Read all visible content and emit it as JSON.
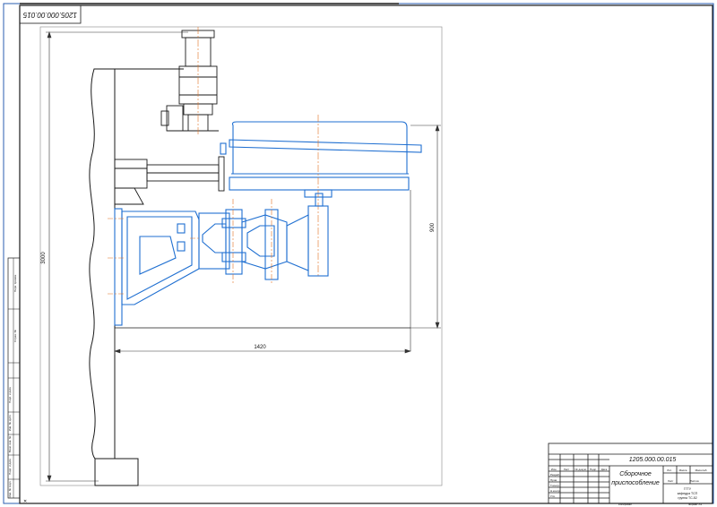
{
  "drawing": {
    "code": "1205.000.00.015",
    "code_rotated": "1205.000.00.015",
    "title_line1": "Сборочное",
    "title_line2": "приспособление"
  },
  "dimensions": {
    "height_left": "3000",
    "height_right": "900",
    "width_bottom": "1420"
  },
  "title_block": {
    "col_headers": [
      "Изм.",
      "Лист",
      "№ докум.",
      "Подп.",
      "Дата"
    ],
    "rows": [
      "Разраб.",
      "Пров.",
      "Т.контр.",
      "Н.контр.",
      "Утв."
    ],
    "stage_label": "Лит.",
    "mass_label": "Масса",
    "scale_label": "Масштаб",
    "sheet_label": "Лист",
    "sheets_label": "Листов",
    "org_line1": "ГГТУ",
    "org_line2": "кафедра ТСП",
    "org_line3": "группа ТС-52",
    "copied_label": "Копировал",
    "format_label": "Формат A1"
  },
  "side_stamp": {
    "labels": [
      "Перв. примен.",
      "Справ. №",
      "Подп. и дата",
      "Инв. № дубл.",
      "Взам. инв. №",
      "Подп. и дата",
      "Инв. № подл."
    ]
  },
  "colors": {
    "part_outline": "#1f6fd1",
    "frame": "#1a1a1a",
    "axis": "#e07020",
    "dimension": "#333333"
  }
}
